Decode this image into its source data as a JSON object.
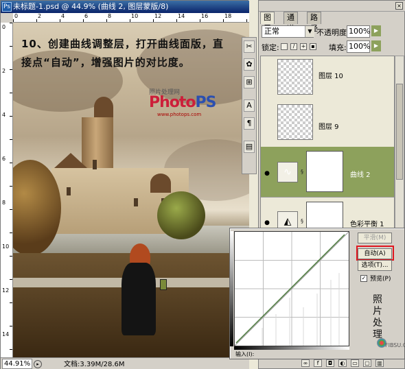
{
  "document": {
    "title": "未标题-1.psd @ 44.9% (曲线 2, 图层蒙版/8)",
    "ruler_top_ticks": [
      "0",
      "2",
      "4",
      "6",
      "8",
      "10",
      "12",
      "14",
      "16",
      "18"
    ],
    "ruler_left_ticks": [
      "0",
      "2",
      "4",
      "6",
      "8",
      "10",
      "12",
      "14"
    ],
    "zoom": "44.91%",
    "doc_size": "文档:3.39M/28.6M"
  },
  "artwork": {
    "tutorial_text": "10、创建曲线调整层，打开曲线面版，直接点“自动”，增强图片的对比度。",
    "watermark_small": "照片处理网",
    "watermark_logo_left": "Photo",
    "watermark_logo_right": "PS",
    "watermark_url": "www.photops.com"
  },
  "tools": [
    "✂",
    "✿",
    "⊞",
    "A",
    "¶",
    "▤"
  ],
  "layers_panel": {
    "tabs": [
      "图层",
      "通道",
      "路径"
    ],
    "active_tab": 0,
    "blend_mode": "正常",
    "opacity_label": "不透明度:",
    "opacity_value": "100%",
    "lock_label": "锁定:",
    "fill_label": "填充:",
    "fill_value": "100%",
    "layers": [
      {
        "name": "图层 10",
        "visible": false,
        "kind": "pixel",
        "selected": false
      },
      {
        "name": "图层 9",
        "visible": false,
        "kind": "pixel",
        "selected": false
      },
      {
        "name": "曲线 2",
        "visible": true,
        "kind": "curves",
        "selected": true
      },
      {
        "name": "色彩平衡 1",
        "visible": true,
        "kind": "balance",
        "selected": false
      }
    ]
  },
  "curves_dialog": {
    "smooth_label": "平滑(M)",
    "auto_label": "自动(A)",
    "options_label": "选项(T)...",
    "preview_label": "预览(P)",
    "preview_checked": true,
    "input_label": "输入(I):",
    "calligraphy": "照片处理",
    "site_logo": "FIBSU.COM"
  },
  "colors": {
    "selected_layer": "#8da15c",
    "highlight": "#e0171f",
    "titlebar": "#0a246a"
  }
}
